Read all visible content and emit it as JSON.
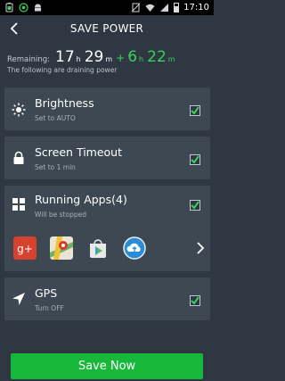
{
  "status_bar": {
    "time": "17:10"
  },
  "header": {
    "title": "SAVE POWER"
  },
  "remaining": {
    "label": "Remaining:",
    "hours": "17",
    "hours_unit": "h",
    "minutes": "29",
    "minutes_unit": "m",
    "plus": "+",
    "extra_hours": "6",
    "extra_hours_unit": "h",
    "extra_minutes": "22",
    "extra_minutes_unit": "m"
  },
  "drain_note": "The following are draining power",
  "items": [
    {
      "title": "Brightness",
      "subtitle": "Set to AUTO",
      "checked": true
    },
    {
      "title": "Screen Timeout",
      "subtitle": "Set to 1 min",
      "checked": true
    },
    {
      "title": "Running Apps(4)",
      "subtitle": "Will be stopped",
      "checked": true
    },
    {
      "title": "GPS",
      "subtitle": "Turn OFF",
      "checked": true
    }
  ],
  "running_apps": [
    "google-plus-icon",
    "maps-icon",
    "play-store-icon",
    "cloud-app-icon"
  ],
  "save_button": "Save Now",
  "colors": {
    "accent": "#18b93a",
    "background": "#2e3742",
    "card": "#3e4853",
    "check": "#39d15a"
  }
}
